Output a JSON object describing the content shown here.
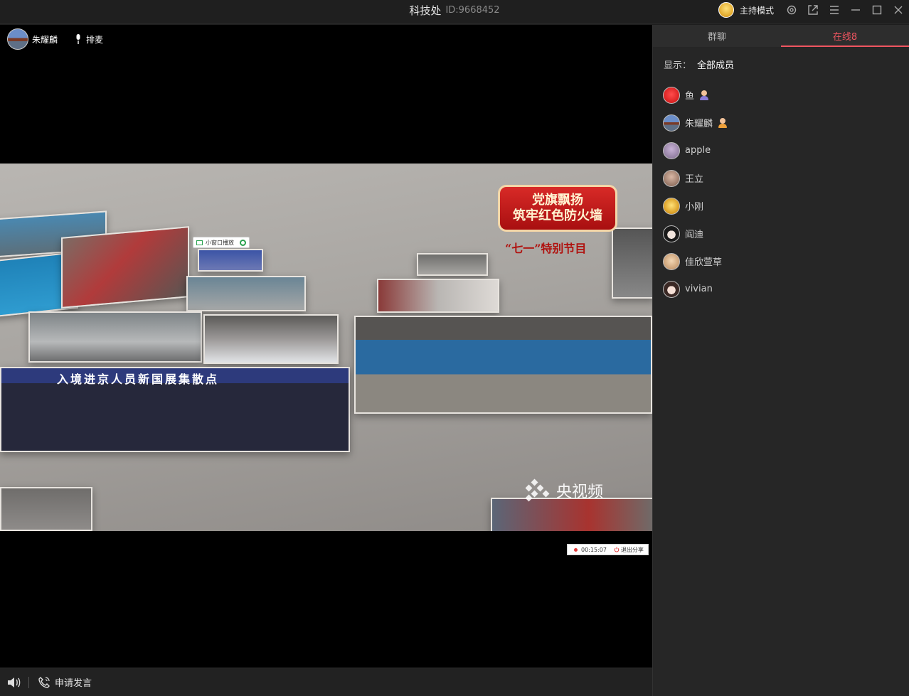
{
  "window": {
    "title": "科技处",
    "room_id": "ID:9668452",
    "host_mode_label": "主持模式",
    "controls": [
      "settings-icon",
      "popout-icon",
      "menu-icon",
      "minimize-icon",
      "maximize-icon",
      "close-icon"
    ]
  },
  "video": {
    "presenter_name": "朱耀麟",
    "mic_queue_label": "排麦",
    "shared_content": {
      "banner_line1": "党旗飘扬",
      "banner_line2": "筑牢红色防火墙",
      "banner_subtitle": "“七一”特别节目",
      "photo_caption": "入境进京人员新国展集散点",
      "watermark": "央视频",
      "mini_window_label": "小窗口播放"
    },
    "recording": {
      "elapsed": "00:15:07",
      "exit_label": "退出分享"
    }
  },
  "bottombar": {
    "volume_icon": "speaker-icon",
    "request_speak_label": "申请发言"
  },
  "sidebar": {
    "tabs": [
      {
        "label": "群聊",
        "active": false
      },
      {
        "label": "在线8",
        "active": true
      }
    ],
    "filter_label": "显示：",
    "filter_value": "全部成员",
    "members": [
      {
        "name": "鱼",
        "role": "host"
      },
      {
        "name": "朱耀麟",
        "role": "presenter"
      },
      {
        "name": "apple",
        "role": ""
      },
      {
        "name": "王立",
        "role": ""
      },
      {
        "name": "小刚",
        "role": ""
      },
      {
        "name": "阎迪",
        "role": ""
      },
      {
        "name": "佳欣萱草",
        "role": ""
      },
      {
        "name": "vivian",
        "role": ""
      }
    ]
  },
  "colors": {
    "accent": "#f05560",
    "background": "#1e1e1e",
    "sidebar_bg": "#262626",
    "host_badge": "#8a7bd8",
    "presenter_badge": "#f0a13a"
  }
}
